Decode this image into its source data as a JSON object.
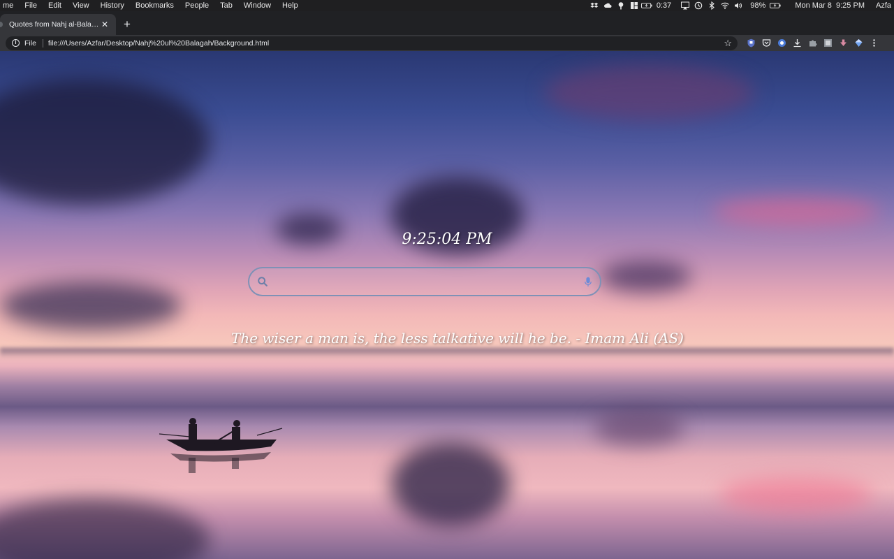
{
  "menubar": {
    "app_name": "me",
    "items": [
      "File",
      "Edit",
      "View",
      "History",
      "Bookmarks",
      "People",
      "Tab",
      "Window",
      "Help"
    ],
    "battery_time": "0:37",
    "battery_percent": "98%",
    "clock": "Mon Mar 8  9:25 PM",
    "user": "Azfa",
    "status_icons": [
      "dropbox-icon",
      "cloud-icon",
      "pin-icon",
      "grid-icon",
      "battery-icon",
      "airplay-icon",
      "time-machine-icon",
      "bluetooth-icon",
      "wifi-icon",
      "volume-icon",
      "battery-icon"
    ]
  },
  "tabs": [
    {
      "title": "Quotes from Nahj al-Balagha",
      "close": "✕"
    }
  ],
  "new_tab_label": "+",
  "toolbar": {
    "scheme": "File",
    "url": "file:///Users/Azfar/Desktop/Nahj%20ul%20Balagah/Background.html",
    "extensions": [
      "shield-icon",
      "pocket-icon",
      "globe-icon",
      "download-icon",
      "puzzle-icon",
      "screenshot-icon",
      "arrow-down-icon",
      "diamond-icon",
      "menu-icon"
    ]
  },
  "page": {
    "clock_text": "9:25:04 PM",
    "search_placeholder": "",
    "search_value": "",
    "quote": "The wiser a man is, the less talkative will he be. - Imam Ali (AS)"
  },
  "colors": {
    "search_border": "#7f91b6",
    "accent": "#1a73e8"
  }
}
